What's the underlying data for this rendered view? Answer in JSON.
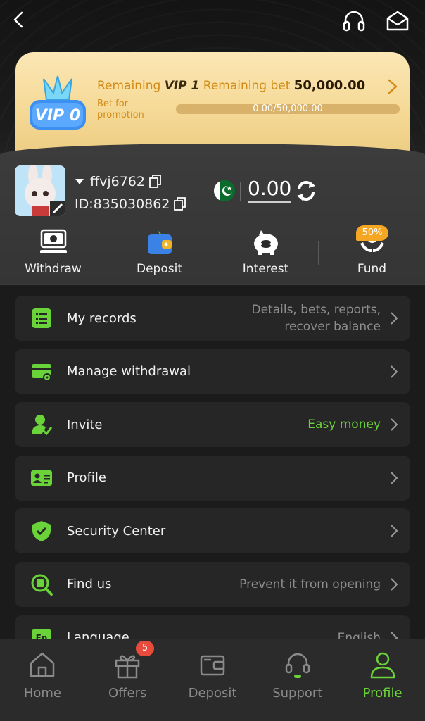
{
  "vip": {
    "remaining_label": "Remaining",
    "next_level": "VIP 1",
    "remaining_bet_label": "Remaining bet",
    "remaining_bet_amount": "50,000.00",
    "bet_for_promotion": "Bet for promotion",
    "progress_text": "0.00/50,000.00",
    "progress": 0,
    "badge_text": "VIP 0"
  },
  "user": {
    "username": "ffvj6762",
    "id_text": "ID:835030862",
    "balance": "0.00",
    "currency_flag": "pakistan-flag"
  },
  "quick_actions": [
    {
      "label": "Withdraw",
      "icon": "withdraw-icon"
    },
    {
      "label": "Deposit",
      "icon": "wallet-icon"
    },
    {
      "label": "Interest",
      "icon": "piggy-bank-icon"
    },
    {
      "label": "Fund",
      "icon": "fund-icon",
      "badge": "50%"
    }
  ],
  "menu": [
    {
      "label": "My records",
      "hint": "Details, bets, reports, recover balance",
      "icon": "records-icon"
    },
    {
      "label": "Manage withdrawal",
      "hint": "",
      "icon": "card-gear-icon"
    },
    {
      "label": "Invite",
      "hint": "Easy money",
      "icon": "invite-icon"
    },
    {
      "label": "Profile",
      "hint": "",
      "icon": "id-card-icon"
    },
    {
      "label": "Security Center",
      "hint": "",
      "icon": "shield-icon"
    },
    {
      "label": "Find us",
      "hint": "Prevent it from opening",
      "icon": "find-us-icon"
    },
    {
      "label": "Language",
      "hint": "English",
      "icon": "language-icon"
    }
  ],
  "nav": [
    {
      "label": "Home",
      "icon": "home-icon"
    },
    {
      "label": "Offers",
      "icon": "gift-icon",
      "badge": "5"
    },
    {
      "label": "Deposit",
      "icon": "wallet-icon"
    },
    {
      "label": "Support",
      "icon": "support-icon"
    },
    {
      "label": "Profile",
      "icon": "profile-icon",
      "active": true
    }
  ],
  "colors": {
    "accent_green": "#6bd33a",
    "gold": "#d18a14",
    "badge_red": "#e84a3c",
    "badge_orange": "#f5a623"
  }
}
